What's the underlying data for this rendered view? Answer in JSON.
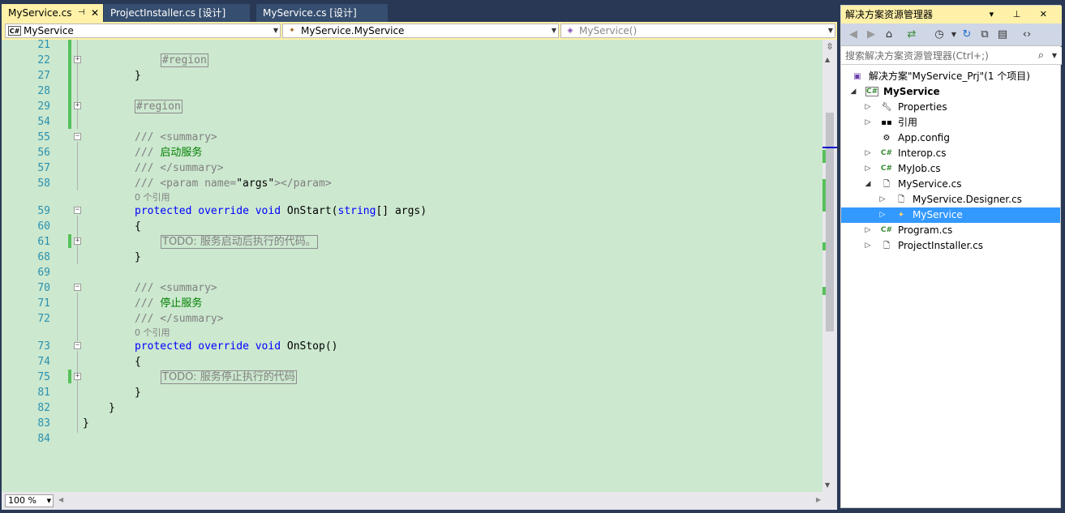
{
  "tabs": [
    {
      "label": "MyService.cs",
      "active": true,
      "pin_icon": "pin-icon",
      "close_icon": "close-icon"
    },
    {
      "label": "ProjectInstaller.cs [设计]",
      "active": false
    },
    {
      "label": "MyService.cs [设计]",
      "active": false
    }
  ],
  "navbar": {
    "project": "MyService",
    "type": "MyService.MyService",
    "member": "MyService()"
  },
  "code": {
    "lines": [
      {
        "num": "21"
      },
      {
        "num": "22"
      },
      {
        "num": "27"
      },
      {
        "num": "28"
      },
      {
        "num": "29"
      },
      {
        "num": "54"
      },
      {
        "num": "55"
      },
      {
        "num": "56"
      },
      {
        "num": "57"
      },
      {
        "num": "58"
      },
      {
        "num": "59"
      },
      {
        "num": "60"
      },
      {
        "num": "61"
      },
      {
        "num": "68"
      },
      {
        "num": "69"
      },
      {
        "num": "70"
      },
      {
        "num": "71"
      },
      {
        "num": "72"
      },
      {
        "num": "73"
      },
      {
        "num": "74"
      },
      {
        "num": "75"
      },
      {
        "num": "81"
      },
      {
        "num": "82"
      },
      {
        "num": "83"
      },
      {
        "num": "84"
      }
    ],
    "region1": "#region",
    "brace_close": "}",
    "brace_open": "{",
    "region2": "#region",
    "summary_open": "/// <summary>",
    "start_summary_prefix": "///",
    "start_summary_text": "启动服务",
    "summary_close": "/// </summary>",
    "param_prefix": "/// <param name=",
    "param_name": "\"args\"",
    "param_suffix": "></param>",
    "ref_count_1": "0 个引用",
    "kw_protected": "protected",
    "kw_override": "override",
    "kw_void": "void",
    "onstart_name": "OnStart(",
    "kw_string": "string",
    "onstart_args": "[] args)",
    "todo_start": "TODO: 服务启动后执行的代码。",
    "stop_summary_prefix": "///",
    "stop_summary_text": "停止服务",
    "ref_count_2": "0 个引用",
    "onstop_name": "OnStop()",
    "todo_stop": "TODO: 服务停止执行的代码"
  },
  "zoom": "100 %",
  "solution_explorer": {
    "title": "解决方案资源管理器",
    "title_buttons": "▾ ⊥ ✕",
    "search_placeholder": "搜索解决方案资源管理器(Ctrl+;)",
    "tree": [
      {
        "label": "解决方案\"MyService_Prj\"(1 个项目)",
        "icon": "solution-icon",
        "level": 0
      },
      {
        "label": "MyService",
        "icon": "csharp-project-icon",
        "level": 0,
        "bold": true
      },
      {
        "label": "Properties",
        "icon": "wrench-icon",
        "level": 1
      },
      {
        "label": "引用",
        "icon": "references-icon",
        "level": 1
      },
      {
        "label": "App.config",
        "icon": "config-file-icon",
        "level": 1
      },
      {
        "label": "Interop.cs",
        "icon": "csharp-file-icon",
        "level": 1
      },
      {
        "label": "MyJob.cs",
        "icon": "csharp-file-icon",
        "level": 1
      },
      {
        "label": "MyService.cs",
        "icon": "component-file-icon",
        "level": 1
      },
      {
        "label": "MyService.Designer.cs",
        "icon": "designer-file-icon",
        "level": 2
      },
      {
        "label": "MyService",
        "icon": "class-icon",
        "level": 2,
        "selected": true
      },
      {
        "label": "Program.cs",
        "icon": "csharp-file-icon",
        "level": 1
      },
      {
        "label": "ProjectInstaller.cs",
        "icon": "component-file-icon",
        "level": 1
      }
    ]
  },
  "colors": {
    "editor_bg": "#cce8cf",
    "keyword": "#0000ff",
    "comment_text": "#008000",
    "line_number": "#2b91af",
    "active_tab": "#fff1a8",
    "selection": "#3399ff"
  }
}
